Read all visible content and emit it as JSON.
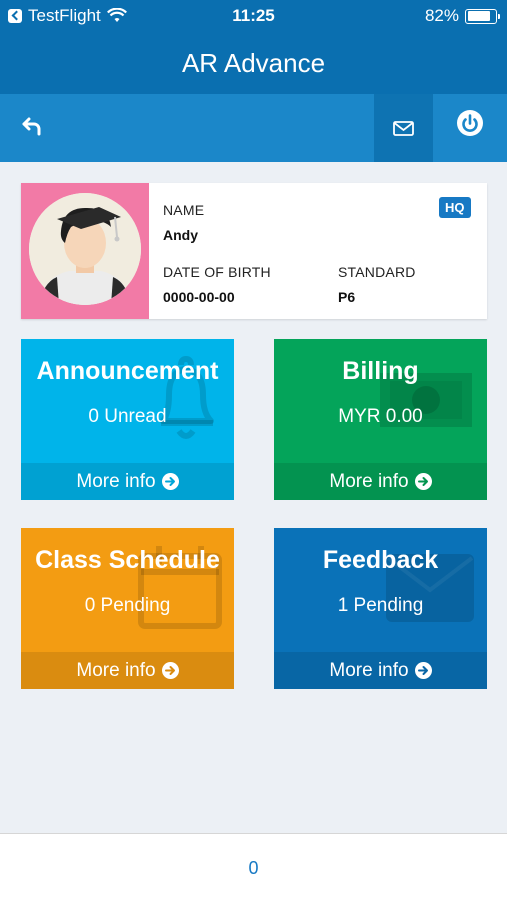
{
  "status_bar": {
    "carrier": "TestFlight",
    "time": "11:25",
    "battery": "82%"
  },
  "header": {
    "title": "AR Advance"
  },
  "toolbar": {
    "back_icon": "undo-arrow-icon",
    "mail_icon": "envelope-icon",
    "power_icon": "power-icon"
  },
  "profile": {
    "name_label": "NAME",
    "name": "Andy",
    "dob_label": "DATE OF BIRTH",
    "dob": "0000-00-00",
    "standard_label": "STANDARD",
    "standard": "P6",
    "badge": "HQ",
    "photo_bg_color": "#f27aa6"
  },
  "tiles": [
    {
      "title": "Announcement",
      "subtitle": "0 Unread",
      "footer": "More info",
      "color": "#00b4ea",
      "icon": "bell-icon"
    },
    {
      "title": "Billing",
      "subtitle": "MYR 0.00",
      "footer": "More info",
      "color": "#04a45a",
      "icon": "money-icon"
    },
    {
      "title": "Class Schedule",
      "subtitle": "0 Pending",
      "footer": "More info",
      "color": "#f39c12",
      "icon": "calendar-icon"
    },
    {
      "title": "Feedback",
      "subtitle": "1 Pending",
      "footer": "More info",
      "color": "#0a72b8",
      "icon": "envelope-icon"
    }
  ],
  "bottom_bar": {
    "count": "0"
  }
}
